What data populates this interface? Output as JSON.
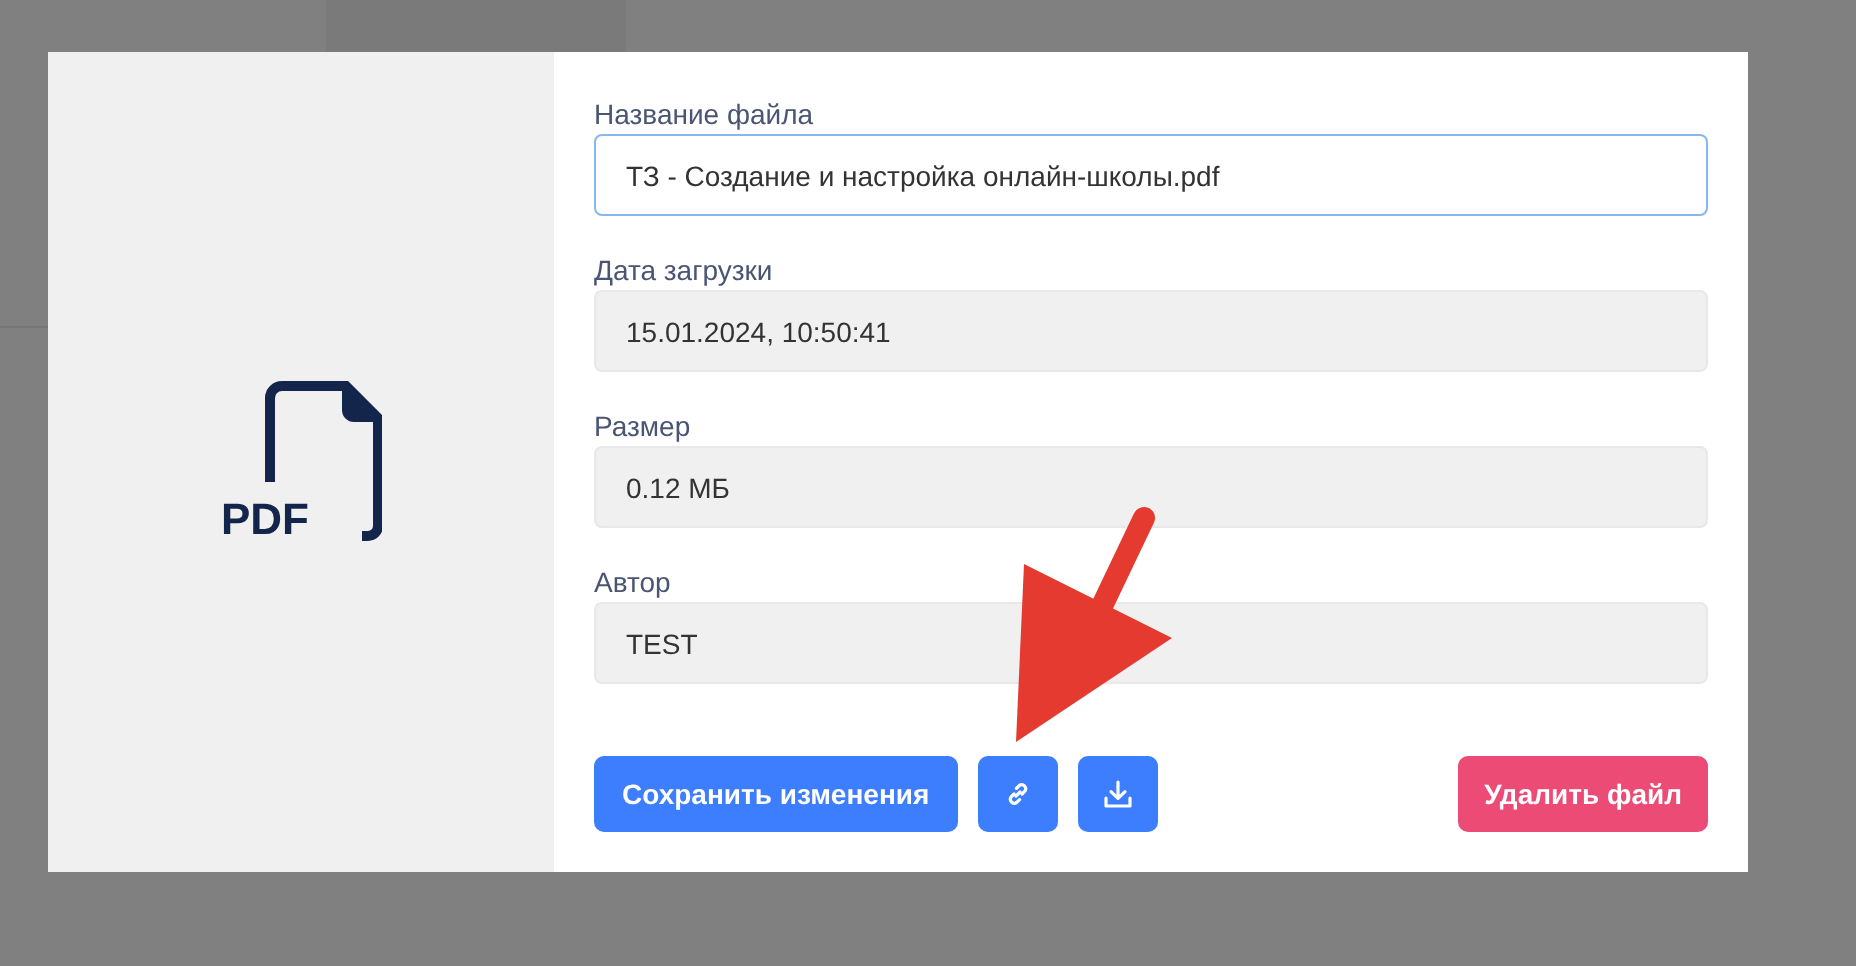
{
  "file_panel": {
    "icon_label": "PDF"
  },
  "fields": [
    {
      "label": "Название файла",
      "value": "ТЗ - Создание и настройка онлайн-школы.pdf",
      "kind": "editable",
      "focused": true
    },
    {
      "label": "Дата загрузки",
      "value": "15.01.2024, 10:50:41",
      "kind": "readonly",
      "focused": false
    },
    {
      "label": "Размер",
      "value": "0.12 МБ",
      "kind": "readonly",
      "focused": false
    },
    {
      "label": "Автор",
      "value": "TEST",
      "kind": "readonly",
      "focused": false
    }
  ],
  "actions": [
    {
      "kind": "primary",
      "label": "Сохранить изменения"
    },
    {
      "kind": "link"
    },
    {
      "kind": "download"
    },
    {
      "kind": "danger",
      "label": "Удалить файл"
    }
  ]
}
